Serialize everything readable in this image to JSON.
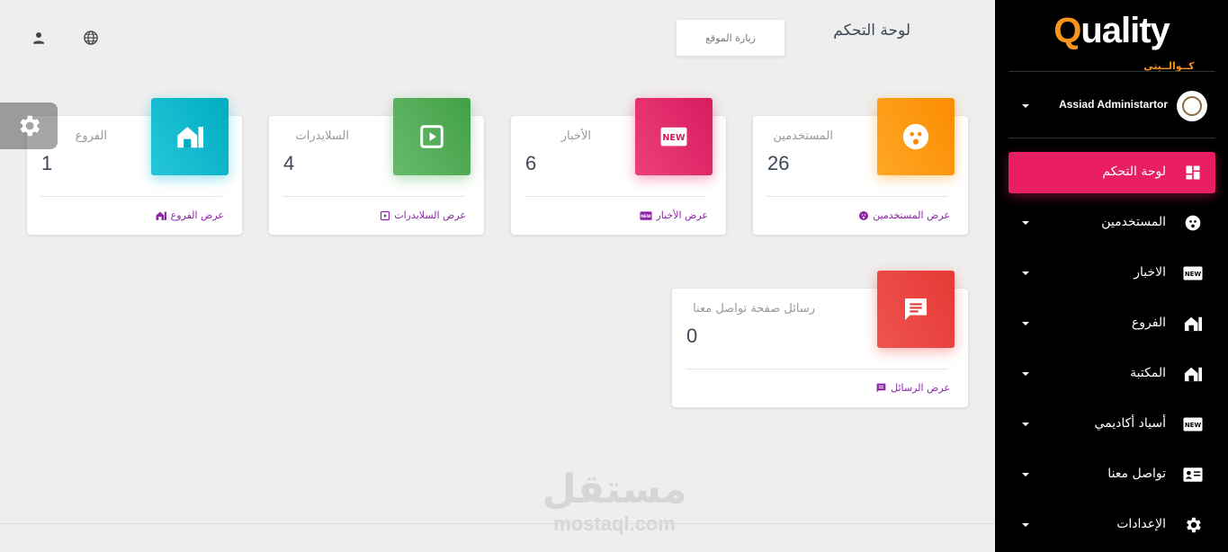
{
  "brand": {
    "logo_main": "uality",
    "logo_q": "Q",
    "logo_sub": "كــوالــيتي",
    "accent": "#e91e63",
    "sidebar_bg": "#000000"
  },
  "user": {
    "name": "Assiad Administartor",
    "avatar_icon": "emblem-icon"
  },
  "sidebar": {
    "items": [
      {
        "label": "لوحة التحكم",
        "icon": "dashboard-icon",
        "active": true
      },
      {
        "label": "المستخدمين",
        "icon": "users-face-icon"
      },
      {
        "label": "الاخبار",
        "icon": "new-badge-icon"
      },
      {
        "label": "الفروع",
        "icon": "store-icon"
      },
      {
        "label": "المكتبة",
        "icon": "store-icon"
      },
      {
        "label": "أسياد أكاديمي",
        "icon": "new-badge-icon"
      },
      {
        "label": "تواصل معنا",
        "icon": "contact-card-icon"
      },
      {
        "label": "الإعدادات",
        "icon": "gear-icon"
      }
    ]
  },
  "header": {
    "title": "لوحة التحكم",
    "visit_site": "زيارة الموقع"
  },
  "cards": [
    {
      "category": "المستخدمين",
      "value": "26",
      "footer": "عرض المستخدمين",
      "color": "#ff9800",
      "icon": "users-face-icon"
    },
    {
      "category": "الأخبار",
      "value": "6",
      "footer": "عرض الأخبار",
      "color": "#e91e63",
      "icon": "new-badge-icon"
    },
    {
      "category": "السلايدرات",
      "value": "4",
      "footer": "عرض السلايدرات",
      "color": "#4caf50",
      "icon": "play-box-icon"
    },
    {
      "category": "الفروع",
      "value": "1",
      "footer": "عرض الفروع",
      "color": "#00bcd4",
      "icon": "store-icon"
    },
    {
      "category": "رسائل صفحة تواصل معنا",
      "value": "0",
      "footer": "عرض الرسائل",
      "color": "#f44336",
      "icon": "message-icon"
    }
  ],
  "watermark": {
    "arabic": "مستقل",
    "latin": "mostaql.com"
  }
}
